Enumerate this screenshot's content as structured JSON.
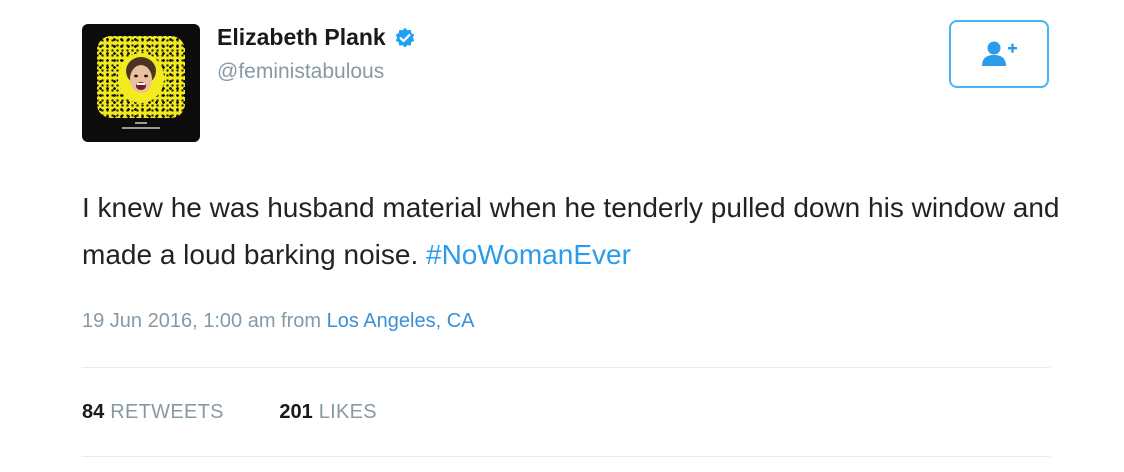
{
  "tweet": {
    "author": {
      "name": "Elizabeth Plank",
      "handle": "@feministabulous",
      "verified": true,
      "avatar": "snapcode-avatar"
    },
    "follow_button_icon": "follow-user-icon",
    "text": "I knew he was husband material when he tenderly pulled down his window and made a loud barking noise.",
    "hashtag": "#NoWomanEver",
    "timestamp": "19 Jun 2016, 1:00 am",
    "from_label": "from",
    "location": "Los Angeles, CA",
    "stats": {
      "retweets_count": "84",
      "retweets_label": "RETWEETS",
      "likes_count": "201",
      "likes_label": "LIKES"
    }
  },
  "colors": {
    "link": "#2b9ceb",
    "secondary_text": "#8899a6",
    "follow_border": "#4ab3f4",
    "verified_badge": "#1da1f2",
    "snapcode_yellow": "#f2ec1f"
  }
}
